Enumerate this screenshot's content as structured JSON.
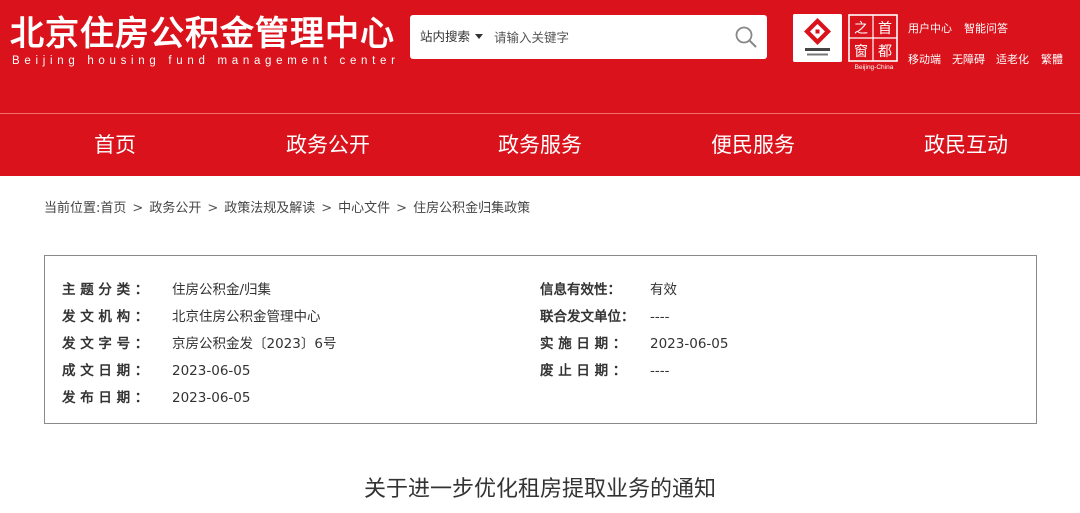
{
  "header": {
    "title": "北京住房公积金管理中心",
    "subtitle": "Beijing housing fund management center",
    "search": {
      "scope_label": "站内搜索",
      "placeholder": "请输入关键字"
    },
    "logo2_caption": "Beijing-China",
    "utility_links": [
      "用户中心",
      "智能问答",
      "移动端",
      "无障碍",
      "适老化",
      "繁體"
    ]
  },
  "nav": {
    "items": [
      "首页",
      "政务公开",
      "政务服务",
      "便民服务",
      "政民互动"
    ]
  },
  "breadcrumb": {
    "prefix": "当前位置:",
    "items": [
      "首页",
      "政务公开",
      "政策法规及解读",
      "中心文件",
      "住房公积金归集政策"
    ],
    "separator": ">"
  },
  "info": {
    "topic": {
      "label": "主 题 分 类 ：",
      "value": "住房公积金/归集"
    },
    "issuer": {
      "label": "发 文 机 构 ：",
      "value": "北京住房公积金管理中心"
    },
    "doc_number": {
      "label": "发 文 字 号 ：",
      "value": "京房公积金发〔2023〕6号"
    },
    "written_date": {
      "label": "成 文 日 期 ：",
      "value": "2023-06-05"
    },
    "publish_date": {
      "label": "发 布 日 期 ：",
      "value": "2023-06-05"
    },
    "validity": {
      "label": "信息有效性：",
      "value": "有效"
    },
    "joint_issuer": {
      "label": "联合发文单位：",
      "value": "----"
    },
    "effective_date": {
      "label": "实 施 日 期 ：",
      "value": "2023-06-05"
    },
    "abolish_date": {
      "label": "废 止 日 期 ：",
      "value": "----"
    }
  },
  "article": {
    "title": "关于进一步优化租房提取业务的通知"
  },
  "colors": {
    "brand_red": "#d9121b",
    "text": "#333333",
    "box_border": "#8a8a8a"
  }
}
